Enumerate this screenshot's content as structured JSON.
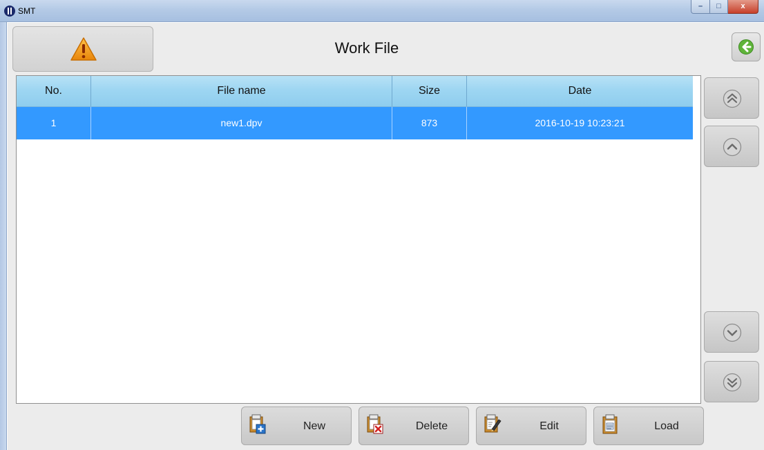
{
  "window": {
    "title": "SMT",
    "minimize_glyph": "–",
    "maximize_glyph": "□",
    "close_glyph": "x"
  },
  "header": {
    "title": "Work File",
    "alarm_icon": "warning-triangle-icon",
    "back_icon": "back-arrow-icon"
  },
  "table": {
    "columns": [
      "No.",
      "File name",
      "Size",
      "Date"
    ],
    "rows": [
      {
        "no": "1",
        "file_name": "new1.dpv",
        "size": "873",
        "date": "2016-10-19 10:23:21",
        "selected": true
      }
    ]
  },
  "scroll": {
    "top_icon": "double-chevron-up-icon",
    "up_icon": "chevron-up-icon",
    "down_icon": "chevron-down-icon",
    "bottom_icon": "double-chevron-down-icon"
  },
  "toolbar": {
    "new_label": "New",
    "delete_label": "Delete",
    "edit_label": "Edit",
    "load_label": "Load"
  },
  "colors": {
    "selection": "#3399ff",
    "header": "#9ed6f2",
    "warning": "#f29a1f",
    "back_arrow": "#5fb43a"
  }
}
